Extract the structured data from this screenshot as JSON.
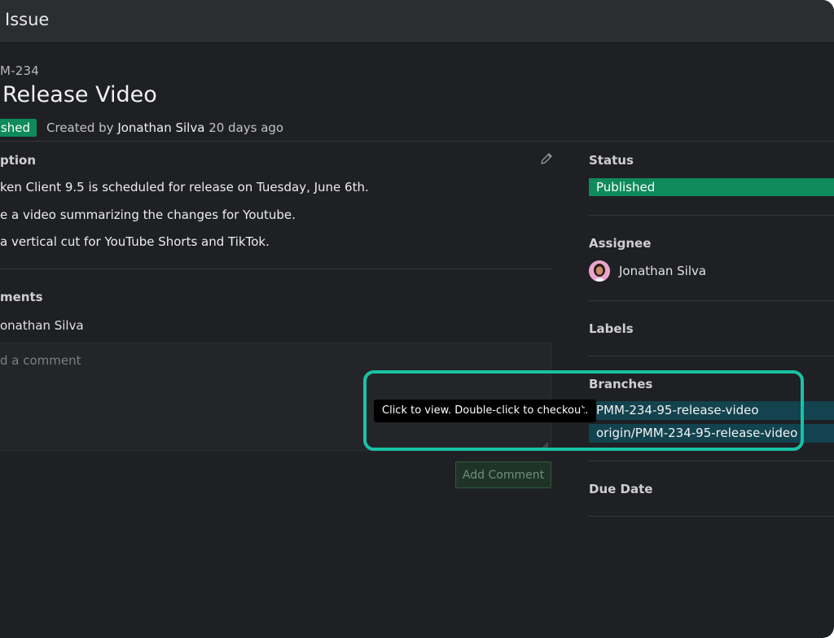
{
  "window": {
    "title": "Issue"
  },
  "issue": {
    "key": "M-234",
    "title": "Release Video",
    "status_badge": "shed",
    "created_prefix": "Created by",
    "created_by": "Jonathan Silva",
    "created_ago": "20 days ago"
  },
  "description": {
    "label": "ption",
    "lines": [
      "ken Client 9.5 is scheduled for release on Tuesday, June 6th.",
      "e a video summarizing the changes for Youtube.",
      "a vertical cut for YouTube Shorts and TikTok."
    ]
  },
  "comments": {
    "label": "ments",
    "author": "onathan Silva",
    "placeholder": "d a comment",
    "add_button": "Add Comment"
  },
  "sidebar": {
    "status_label": "Status",
    "status_value": "Published",
    "assignee_label": "Assignee",
    "assignee_name": "Jonathan Silva",
    "labels_label": "Labels",
    "branches_label": "Branches",
    "branches": [
      "PMM-234-95-release-video",
      "origin/PMM-234-95-release-video"
    ],
    "due_date_label": "Due Date"
  },
  "tooltip": {
    "text": "Click to view. Double-click to checkout."
  },
  "colors": {
    "accent_green": "#0f8a5a",
    "branch_bg": "#12434f",
    "highlight": "#17c3a5"
  },
  "icons": {
    "edit": "pencil-icon",
    "avatar": "user-avatar"
  }
}
